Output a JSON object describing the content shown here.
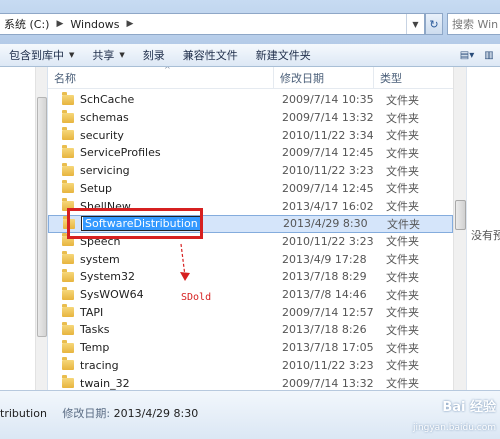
{
  "address": {
    "crumbs": [
      "系统 (C:)",
      "Windows"
    ],
    "search_placeholder": "搜索 Win"
  },
  "toolbar": {
    "include_library": "包含到库中",
    "share": "共享",
    "burn": "刻录",
    "compat_files": "兼容性文件",
    "new_folder": "新建文件夹"
  },
  "columns": {
    "name": "名称",
    "date": "修改日期",
    "type": "类型"
  },
  "files": [
    {
      "name": "SchCache",
      "date": "2009/7/14 10:35",
      "type": "文件夹"
    },
    {
      "name": "schemas",
      "date": "2009/7/14 13:32",
      "type": "文件夹"
    },
    {
      "name": "security",
      "date": "2010/11/22 3:34",
      "type": "文件夹"
    },
    {
      "name": "ServiceProfiles",
      "date": "2009/7/14 12:45",
      "type": "文件夹"
    },
    {
      "name": "servicing",
      "date": "2010/11/22 3:23",
      "type": "文件夹"
    },
    {
      "name": "Setup",
      "date": "2009/7/14 12:45",
      "type": "文件夹"
    },
    {
      "name": "ShellNew",
      "date": "2013/4/17 16:02",
      "type": "文件夹"
    },
    {
      "name": "SoftwareDistribution",
      "date": "2013/4/29 8:30",
      "type": "文件夹"
    },
    {
      "name": "Speech",
      "date": "2010/11/22 3:23",
      "type": "文件夹"
    },
    {
      "name": "system",
      "date": "2013/4/9 17:28",
      "type": "文件夹"
    },
    {
      "name": "System32",
      "date": "2013/7/18 8:29",
      "type": "文件夹"
    },
    {
      "name": "SysWOW64",
      "date": "2013/7/8 14:46",
      "type": "文件夹"
    },
    {
      "name": "TAPI",
      "date": "2009/7/14 12:57",
      "type": "文件夹"
    },
    {
      "name": "Tasks",
      "date": "2013/7/18 8:26",
      "type": "文件夹"
    },
    {
      "name": "Temp",
      "date": "2013/7/18 17:05",
      "type": "文件夹"
    },
    {
      "name": "tracing",
      "date": "2010/11/22 3:23",
      "type": "文件夹"
    },
    {
      "name": "twain_32",
      "date": "2009/7/14 13:32",
      "type": "文件夹"
    }
  ],
  "annotation": "SDold",
  "preview_text": "没有预",
  "details": {
    "name": "tribution",
    "date_label": "修改日期:",
    "date_value": "2013/4/29 8:30"
  },
  "watermark": "Bai 经验",
  "watermark_url": "jingyan.baidu.com"
}
